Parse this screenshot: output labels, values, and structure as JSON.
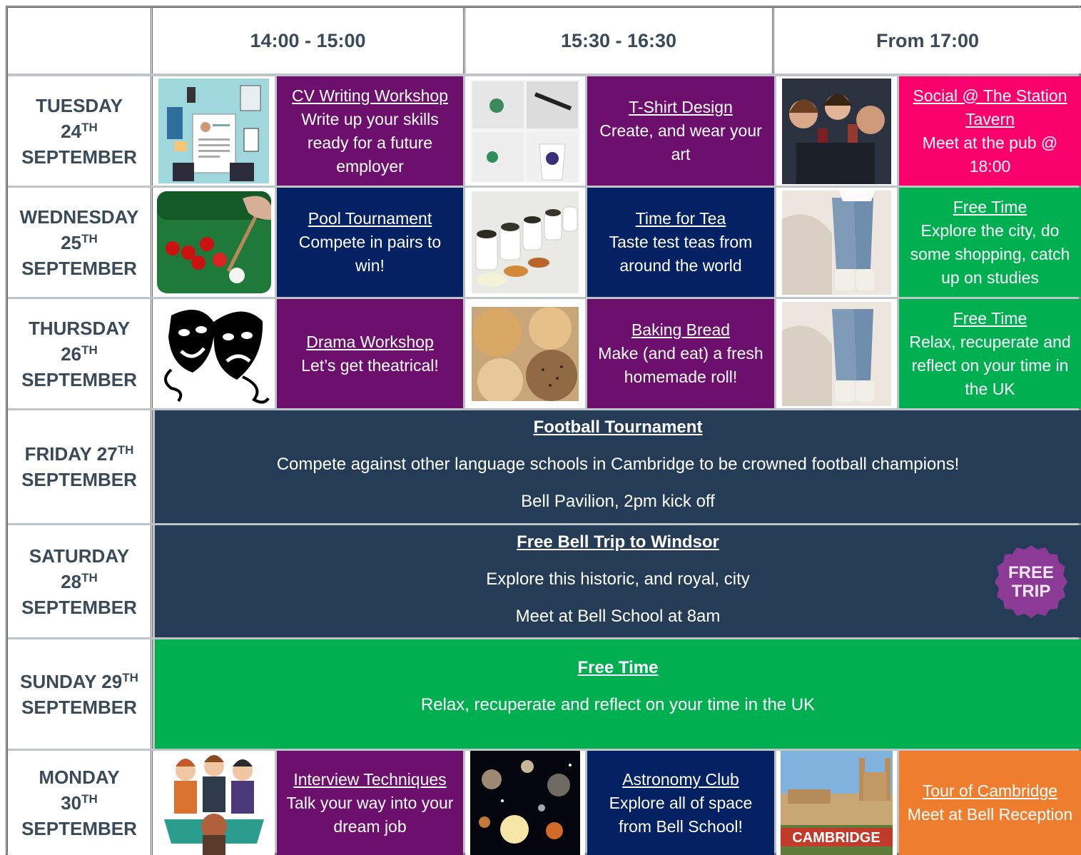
{
  "header": {
    "slot1": "14:00 - 15:00",
    "slot2": "15:30 - 16:30",
    "slot3": "From 17:00"
  },
  "days": {
    "tue": {
      "name": "TUESDAY",
      "num": "24",
      "sup": "TH",
      "month": "SEPTEMBER"
    },
    "wed": {
      "name": "WEDNESDAY",
      "num": "25",
      "sup": "TH",
      "month": "SEPTEMBER"
    },
    "thu": {
      "name": "THURSDAY",
      "num": "26",
      "sup": "TH",
      "month": "SEPTEMBER"
    },
    "fri": {
      "name": "FRIDAY 27",
      "sup": "TH",
      "month": "SEPTEMBER"
    },
    "sat": {
      "name": "SATURDAY",
      "num": "28",
      "sup": "TH",
      "month": "SEPTEMBER"
    },
    "sun": {
      "name": "SUNDAY 29",
      "sup": "TH",
      "month": "SEPTEMBER"
    },
    "mon": {
      "name": "MONDAY",
      "num": "30",
      "sup": "TH",
      "month": "SEPTEMBER"
    }
  },
  "activities": {
    "cv": {
      "title": "CV Writing Workshop",
      "desc": "Write up your skills ready for a future employer"
    },
    "tshirt": {
      "title": "T-Shirt Design",
      "desc": "Create, and wear your art"
    },
    "social": {
      "title": "Social @ The Station Tavern",
      "desc": "Meet at the pub @ 18:00"
    },
    "pool": {
      "title": "Pool Tournament",
      "desc": "Compete in pairs to win!"
    },
    "tea": {
      "title": "Time for Tea",
      "desc": "Taste test teas from around the world"
    },
    "free_wed": {
      "title": "Free Time",
      "desc": "Explore the city, do some shopping, catch up on studies"
    },
    "drama": {
      "title": "Drama Workshop",
      "desc": "Let’s get theatrical!"
    },
    "bread": {
      "title": "Baking Bread",
      "desc": "Make (and eat) a fresh homemade roll!"
    },
    "free_thu": {
      "title": "Free Time",
      "desc": "Relax, recuperate and reflect on your time in the UK"
    },
    "interview": {
      "title": "Interview Techniques",
      "desc": "Talk your way into your dream job"
    },
    "astro": {
      "title": "Astronomy Club",
      "desc": "Explore all of space from Bell School!"
    },
    "tour": {
      "title": "Tour of Cambridge",
      "desc": "Meet at Bell Reception"
    }
  },
  "friday": {
    "title": " Football Tournament",
    "line1": "Compete against other language schools in Cambridge to be crowned football champions!",
    "line2": "Bell Pavilion, 2pm kick off"
  },
  "saturday": {
    "title": "Free Bell Trip to Windsor",
    "line1": "Explore this historic, and royal, city",
    "line2": "Meet at Bell School at 8am",
    "badge_top": "FREE",
    "badge_bottom": "TRIP"
  },
  "sunday": {
    "title": "Free Time",
    "line1": "Relax, recuperate and reflect on your time in the UK"
  },
  "images": {
    "cambridge_caption": "CAMBRIDGE"
  },
  "colors": {
    "purple": "#6d0f6c",
    "navy": "#042263",
    "pink": "#fa006d",
    "green": "#00b050",
    "orange": "#ef7d2e",
    "slate": "#243c55",
    "heading": "#394b59"
  }
}
